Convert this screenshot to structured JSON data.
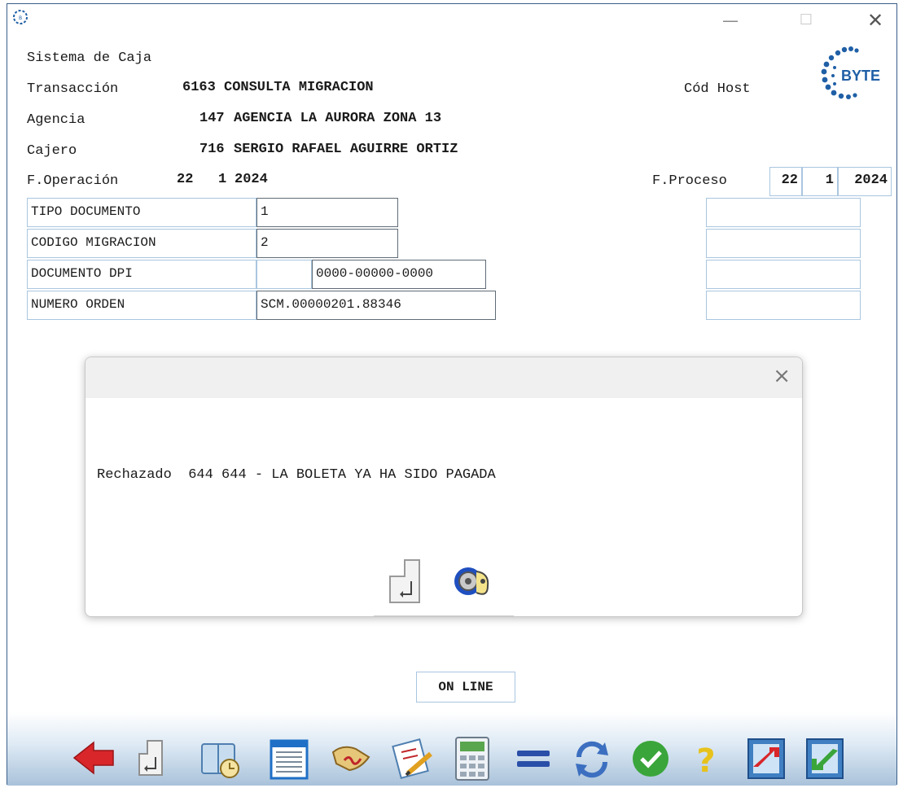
{
  "window": {
    "icon": "byte-app-icon",
    "minimize_glyph": "—",
    "maximize_glyph": "☐",
    "close_glyph": "✕"
  },
  "header": {
    "system_name": "Sistema de Caja",
    "transaccion_label": "Transacción",
    "transaccion_code": "6163",
    "transaccion_name": "CONSULTA MIGRACION",
    "cod_host_label": "Cód Host",
    "agencia_label": "Agencia",
    "agencia_code": "147",
    "agencia_name": "AGENCIA LA AURORA ZONA 13",
    "cajero_label": "Cajero",
    "cajero_code": "716",
    "cajero_name": "SERGIO RAFAEL AGUIRRE ORTIZ",
    "f_operacion_label": "F.Operación",
    "f_operacion_day": "22",
    "f_operacion_month": "1",
    "f_operacion_year": "2024",
    "f_proceso_label": "F.Proceso",
    "f_proceso_day": "22",
    "f_proceso_month": "1",
    "f_proceso_year": "2024"
  },
  "logo": {
    "text": "BYTE"
  },
  "form": {
    "fields": [
      {
        "label": "TIPO DOCUMENTO",
        "value": "1"
      },
      {
        "label": "CODIGO MIGRACION",
        "value": "2"
      },
      {
        "label": "DOCUMENTO DPI",
        "value": "0000-00000-0000"
      },
      {
        "label": "NUMERO ORDEN",
        "value": "SCM.00000201.88346"
      }
    ]
  },
  "modal": {
    "close_glyph": "×",
    "status_word": "Rechazado",
    "message": "644 644 - LA BOLETA YA HA SIDO PAGADA",
    "buttons": [
      "enter-icon",
      "key-icon"
    ]
  },
  "status": {
    "text": "ON LINE"
  },
  "toolbar": {
    "icons": [
      "back-arrow-icon",
      "enter-icon",
      "book-clock-icon",
      "list-document-icon",
      "scroll-signature-icon",
      "checklist-pencil-icon",
      "calculator-icon",
      "equals-icon",
      "refresh-icon",
      "check-icon",
      "help-icon",
      "export-icon",
      "import-icon"
    ]
  },
  "colors": {
    "accent_blue": "#1f5fa6",
    "field_border": "#a9c6e0",
    "back_red": "#d8262a",
    "ok_green": "#3aa53a",
    "help_yellow": "#e7c21c"
  }
}
